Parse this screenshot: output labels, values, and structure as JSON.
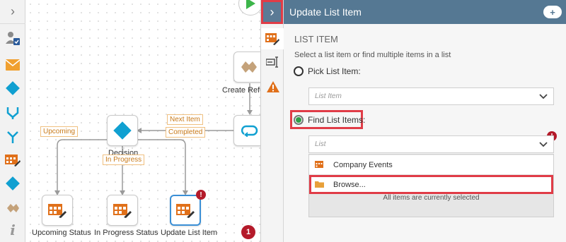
{
  "panel": {
    "title": "Update List Item",
    "section_title": "LIST ITEM",
    "hint": "Select a list item or find multiple items in a list",
    "pick_label": "Pick List Item:",
    "pick_placeholder": "List Item",
    "find_label": "Find List Items:",
    "list_placeholder": "List",
    "dropdown_items": [
      "Company Events",
      "Browse..."
    ],
    "dropdown_status": "All items are currently selected"
  },
  "canvas": {
    "create_ref_label": "Create Refe",
    "decision_label": "Decision",
    "upcoming_status_label": "Upcoming Status",
    "in_progress_status_label": "In Progress Status",
    "update_list_item_label": "Update List Item",
    "conn_upcoming": "Upcoming",
    "conn_in_progress": "In Progress",
    "conn_next_item": "Next Item",
    "conn_completed": "Completed",
    "error_count": "1",
    "error_mark": "!"
  },
  "colors": {
    "header": "#557893",
    "accent_orange": "#e0701a",
    "accent_blue": "#10a0d1",
    "error": "#b41a2a",
    "highlight": "#e03c47"
  }
}
